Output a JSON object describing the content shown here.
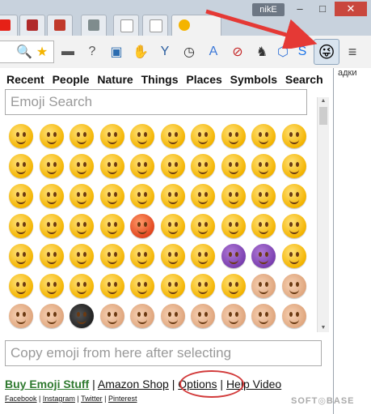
{
  "window": {
    "user_chip": "nikE",
    "minimize": "–",
    "maximize": "□",
    "close": "✕"
  },
  "tabs": [
    {
      "icon": "youtube-icon",
      "color": "#e62117"
    },
    {
      "icon": "ui-icon",
      "color": "#b02a2a"
    },
    {
      "icon": "c-icon",
      "color": "#c0392b"
    },
    {
      "icon": "gt-icon",
      "color": "#7f8c8d"
    },
    {
      "icon": "page-icon",
      "color": "#ffffff"
    },
    {
      "icon": "page-icon",
      "color": "#ffffff"
    },
    {
      "icon": "emoji-icon",
      "color": "#f4b400"
    }
  ],
  "toolbar": {
    "emoji_button_icon": "😜"
  },
  "popup": {
    "categories": [
      "Recent",
      "People",
      "Nature",
      "Things",
      "Places",
      "Symbols",
      "Search"
    ],
    "search_placeholder": "Emoji Search",
    "copy_placeholder": "Copy emoji from here after selecting",
    "links": {
      "buy": "Buy Emoji Stuff",
      "amazon": "Amazon Shop",
      "options": "Options",
      "help": "Help Video",
      "sep": "|"
    },
    "social": [
      "Facebook",
      "Instagram",
      "Twitter",
      "Pinterest"
    ]
  },
  "emoji_rows": [
    [
      "😄",
      "😃",
      "😀",
      "😊",
      "☺",
      "😉",
      "😍",
      "😘",
      "😚",
      "😗"
    ],
    [
      "😙",
      "😜",
      "😝",
      "😛",
      "😳",
      "😁",
      "😔",
      "😌",
      "😒",
      "😞"
    ],
    [
      "😣",
      "😢",
      "😂",
      "😭",
      "😪",
      "😥",
      "😰",
      "😅",
      "😓",
      "😩"
    ],
    [
      "😫",
      "😨",
      "😱",
      "😠",
      "😡",
      "😤",
      "😖",
      "😆",
      "😋",
      "😷"
    ],
    [
      "😎",
      "😴",
      "😵",
      "😲",
      "😟",
      "😦",
      "😧",
      "😈",
      "👿",
      "😮"
    ],
    [
      "😬",
      "😐",
      "😕",
      "😯",
      "😶",
      "😇",
      "😏",
      "😑",
      "👲",
      "👳"
    ],
    [
      "👮",
      "👷",
      "💂",
      "👶",
      "👦",
      "👧",
      "👨",
      "👩",
      "👴",
      "👵"
    ]
  ],
  "side_text": "адки",
  "watermark": "SOFT◎BASE"
}
